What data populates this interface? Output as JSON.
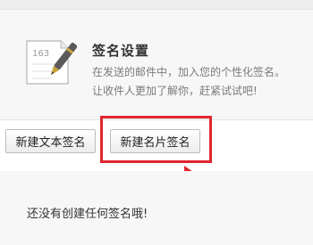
{
  "panel": {
    "icon": "note-pen-icon",
    "note_number": "163",
    "title": "签名设置",
    "desc_line1": "在发送的邮件中，加入您的个性化签名。",
    "desc_line2": "让收件人更加了解你，赶紧试试吧!"
  },
  "buttons": {
    "new_text_signature": "新建文本签名",
    "new_card_signature": "新建名片签名"
  },
  "empty_state": {
    "message": "还没有创建任何签名哦!"
  },
  "colors": {
    "highlight": "#e0262f",
    "panel_bg": "#f7f7f7"
  }
}
